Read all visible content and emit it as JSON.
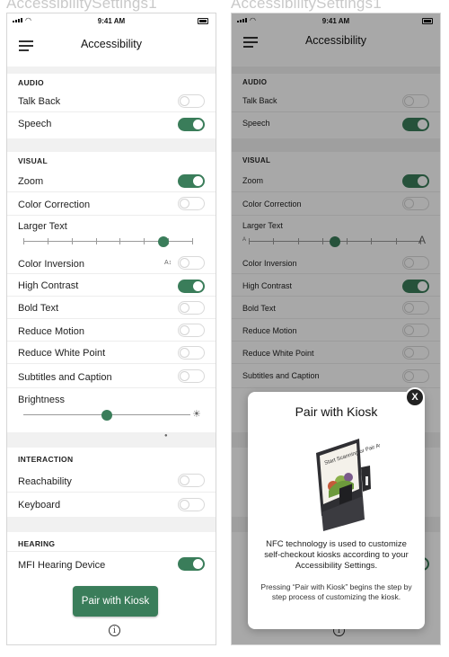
{
  "frames": [
    {
      "title": "AccessibilitySettings1"
    },
    {
      "title": "AccessibilitySettings1"
    }
  ],
  "statusbar": {
    "time": "9:41 AM"
  },
  "appbar": {
    "title": "Accessibility"
  },
  "sections": {
    "audio": {
      "header": "AUDIO",
      "items": [
        {
          "label": "Talk Back",
          "on": false
        },
        {
          "label": "Speech",
          "on": true
        }
      ]
    },
    "visual": {
      "header": "VISUAL",
      "items": [
        {
          "label": "Zoom",
          "on": true
        },
        {
          "label": "Color Correction",
          "on": false
        },
        {
          "label": "Larger Text"
        },
        {
          "label": "Color Inversion",
          "on": false
        },
        {
          "label": "High Contrast",
          "on": true
        },
        {
          "label": "Bold Text",
          "on": false
        },
        {
          "label": "Reduce Motion",
          "on": false
        },
        {
          "label": "Reduce White Point",
          "on": false
        },
        {
          "label": "Subtitles and Caption",
          "on": false
        },
        {
          "label": "Brightness"
        }
      ]
    },
    "interaction": {
      "header": "INTERACTION",
      "items": [
        {
          "label": "Reachability",
          "on": false
        },
        {
          "label": "Keyboard",
          "on": false
        }
      ]
    },
    "hearing": {
      "header": "HEARING",
      "items": [
        {
          "label": "MFI Hearing Device",
          "on": true
        }
      ]
    }
  },
  "larger_text_slider": {
    "value_fraction": 0.83,
    "min_glyph": "A",
    "max_glyph": "A"
  },
  "brightness_slider": {
    "value_fraction": 0.5
  },
  "pair_button": {
    "label": "Pair with Kiosk"
  },
  "info_glyph": "i",
  "modal": {
    "title": "Pair with Kiosk",
    "body": "NFC technology is used to customize self-checkout kiosks according to your Accessibility Settings.",
    "note": "Pressing “Pair with Kiosk” begins the step by step process of customizing the kiosk.",
    "close_label": "X",
    "kiosk_screen_text": "Start Scanning or Pair App"
  },
  "colors": {
    "accent": "#3a7d5a",
    "band": "#f1f1f1"
  }
}
